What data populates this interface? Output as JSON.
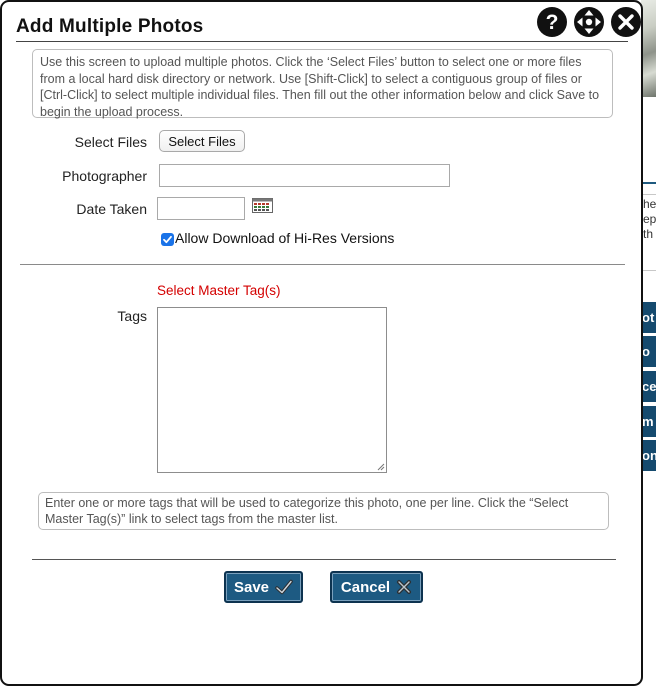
{
  "dialog": {
    "title": "Add Multiple Photos",
    "help_icon": "help-icon",
    "move_icon": "move-icon",
    "close_icon": "close-icon"
  },
  "instructions": "Use this screen to upload multiple photos. Click the ‘Select Files’ button to select one or more files from a local hard disk directory or network. Use [Shift-Click] to select a contiguous group of files or [Ctrl-Click] to select multiple individual files. Then fill out the other information below and click Save to begin the upload process.",
  "form": {
    "select_files_label": "Select Files",
    "select_files_button": "Select Files",
    "photographer_label": "Photographer",
    "photographer_value": "",
    "date_taken_label": "Date Taken",
    "date_taken_value": "",
    "calendar_icon": "calendar-icon",
    "allow_download_checked": true,
    "allow_download_label": "Allow Download of Hi-Res Versions",
    "select_master_tags_link": "Select Master Tag(s)",
    "tags_label": "Tags",
    "tags_value": ""
  },
  "tags_help": "Enter one or more tags that will be used to categorize this photo, one per line. Click the “Select Master Tag(s)” link to select tags from the master list.",
  "actions": {
    "save_label": "Save",
    "cancel_label": "Cancel"
  },
  "background_page": {
    "text_fragments": [
      "he",
      "ep",
      "th"
    ],
    "nav_fragments": [
      "ot",
      "o",
      "ce",
      "m",
      "on"
    ]
  },
  "colors": {
    "button_blue": "#1d5a82",
    "link_red": "#d40000",
    "checkbox_blue": "#1a73e8"
  }
}
